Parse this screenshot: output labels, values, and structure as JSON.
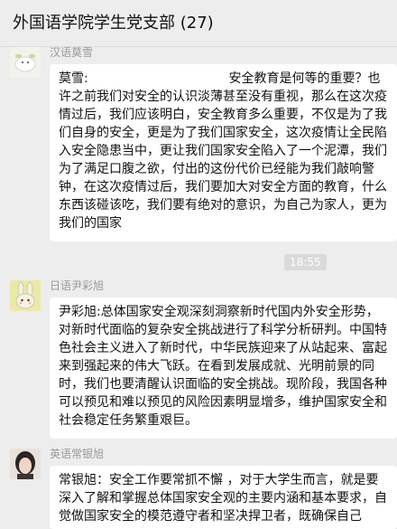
{
  "chat": {
    "title": "外国语学院学生党支部 (27)"
  },
  "messages": [
    {
      "sender": "汉语莫雪",
      "text": "莫雪:                                   安全教育是何等的重要？也许之前我们对安全的认识淡薄甚至没有重视，那么在这次疫情过后，我们应该明白，安全教育多么重要，不仅是为了我们自身的安全，更是为了我们国家安全，这次疫情让全民陷入安全隐患当中，更让我们国家安全陷入了一个泥潭，我们为了满足口腹之欲，付出的这份代价已经能为我们敲响警钟，在这次疫情过后，我们要加大对安全方面的教育，什么东西该碰该吃，我们要有绝对的意识，为自己为家人，更为我们的国家"
    },
    {
      "sender": "日语尹彩旭",
      "text": "尹彩旭:总体国家安全观深刻洞察新时代国内外安全形势，对新时代面临的复杂安全挑战进行了科学分析研判。中国特色社会主义进入了新时代，中华民族迎来了从站起来、富起来到强起来的伟大飞跃。在看到发展成就、光明前景的同时，我们也要清醒认识面临的安全挑战。现阶段，我国各种可以预见和难以预见的风险因素明显增多，维护国家安全和社会稳定任务繁重艰巨。"
    },
    {
      "sender": "英语常银旭",
      "text": "常银旭：安全工作要常抓不懈 ，对于大学生而言，就是要深入了解和掌握总体国家安全观的主要内涵和基本要求，自觉做国家安全的模范遵守者和坚决捍卫者，既确保自己"
    }
  ],
  "timestamp": "18:55"
}
